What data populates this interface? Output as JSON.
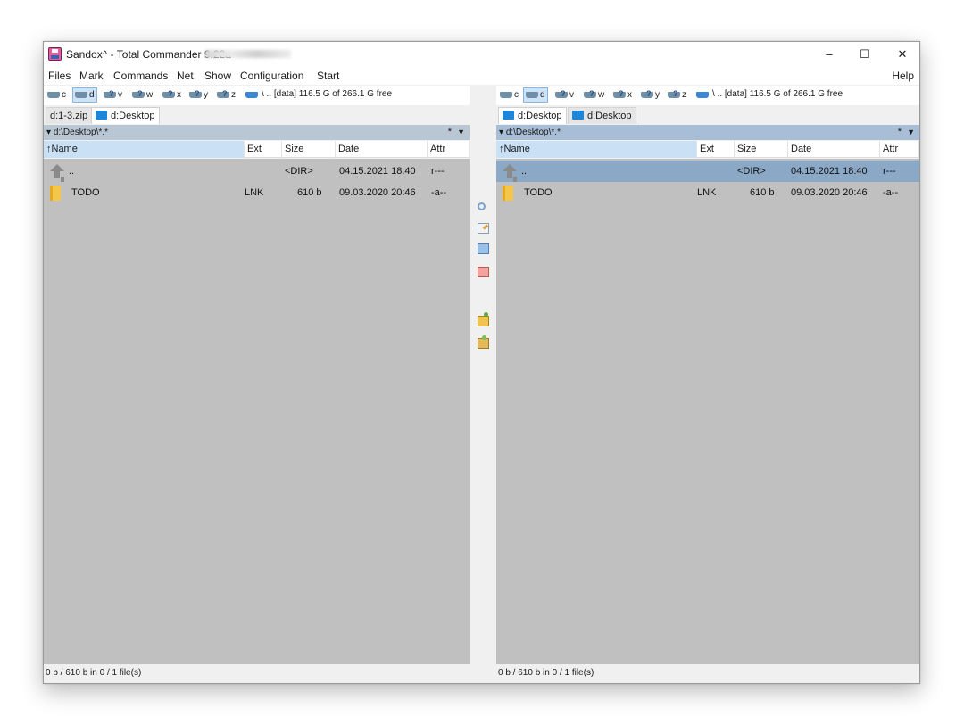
{
  "window": {
    "title": "Sandox^ - Total Commander 9.22a",
    "minimize": "–",
    "maximize": "☐",
    "close": "✕"
  },
  "menu": {
    "items": [
      "Files",
      "Mark",
      "Commands",
      "Net",
      "Show",
      "Configuration",
      "Start"
    ],
    "help": "Help"
  },
  "left": {
    "drives": [
      "c",
      "d",
      "v",
      "w",
      "x",
      "y",
      "z"
    ],
    "active_drive": "d",
    "drive_info": "\\  ..  [data]  116.5 G of 266.1 G free",
    "tabs": [
      "d:1-3.zip",
      "d:Desktop"
    ],
    "active_tab": "d:Desktop",
    "path": "d:\\Desktop\\*.*",
    "path_history": "*",
    "columns": [
      "Name",
      "Ext",
      "Size",
      "Date",
      "Attr"
    ],
    "rows": [
      {
        "name": "..",
        "ext": "",
        "size": "<DIR>",
        "date": "04.15.2021 18:40",
        "attr": "r---",
        "selected": false
      },
      {
        "name": "TODO",
        "ext": "LNK",
        "size": "610 b",
        "date": "09.03.2020 20:46",
        "attr": "-a--",
        "selected": false
      }
    ],
    "status": "0 b / 610 b in 0 / 1 file(s)"
  },
  "right": {
    "drives": [
      "c",
      "d",
      "v",
      "w",
      "x",
      "y",
      "z"
    ],
    "active_drive": "d",
    "drive_info": "\\  ..  [data]  116.5 G of 266.1 G free",
    "tabs": [
      "d:Desktop",
      "d:Desktop"
    ],
    "active_tab": "d:Desktop",
    "path": "d:\\Desktop\\*.*",
    "path_history": "*",
    "columns": [
      "Name",
      "Ext",
      "Size",
      "Date",
      "Attr"
    ],
    "rows": [
      {
        "name": "..",
        "ext": "",
        "size": "<DIR>",
        "date": "04.15.2021 18:40",
        "attr": "r---",
        "selected": true
      },
      {
        "name": "TODO",
        "ext": "LNK",
        "size": "610 b",
        "date": "09.03.2020 20:46",
        "attr": "-a--",
        "selected": false
      }
    ],
    "status": "0 b / 610 b in 0 / 1 file(s)"
  },
  "middle_toolbar": [
    "search-icon",
    "edit-icon",
    "copy-icon",
    "move-icon",
    "pack-icon",
    "new-folder-icon"
  ],
  "colors": {
    "list_background": "#c0c0c0",
    "selected_row": "#8ca8c7",
    "active_path_bar": "#a8bdd6",
    "folder_blue": "#1e86d8"
  }
}
